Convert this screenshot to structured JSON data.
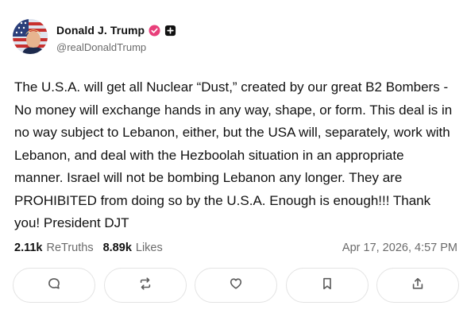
{
  "author": {
    "display_name": "Donald J. Trump",
    "handle": "@realDonaldTrump",
    "badges": [
      "verified-icon",
      "plus-icon"
    ]
  },
  "post": {
    "text": "The U.S.A. will get all Nuclear “Dust,” created by our great B2 Bombers - No money will exchange hands in any way, shape, or form. This deal is in no way subject to Lebanon, either, but the USA will, separately, work with Lebanon, and deal with the Hezboolah situation in an appropriate manner. Israel will not be bombing Lebanon any longer. They are PROHIBITED from doing so by the U.S.A. Enough is enough!!! Thank you! President DJT"
  },
  "stats": {
    "retruths_count": "2.11k",
    "retruths_label": "ReTruths",
    "likes_count": "8.89k",
    "likes_label": "Likes",
    "timestamp": "Apr 17, 2026, 4:57 PM"
  },
  "actions": [
    "reply-icon",
    "retruth-icon",
    "like-icon",
    "bookmark-icon",
    "share-icon"
  ],
  "colors": {
    "verified_badge": "#e83f7a",
    "text": "#111111",
    "muted": "#6b6b6b",
    "button_border": "#e3e3e3"
  }
}
